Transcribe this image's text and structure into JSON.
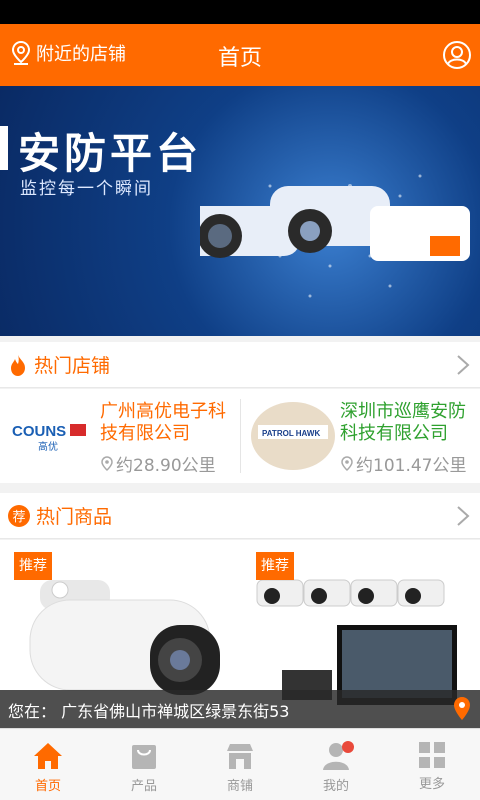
{
  "header": {
    "nearby_label": "附近的店铺",
    "title": "首页"
  },
  "banner": {
    "headline": "安防平台",
    "subtitle": "监控每一个瞬间"
  },
  "hot_stores": {
    "title": "热门店铺",
    "items": [
      {
        "logo_text": "COUNS",
        "logo_sub": "高优",
        "name": "广州高优电子科技有限公司",
        "distance": "约28.90公里"
      },
      {
        "logo_text": "PATROL HAWK",
        "name": "深圳市巡鹰安防科技有限公司",
        "distance": "约101.47公里"
      }
    ]
  },
  "hot_products": {
    "title": "热门商品",
    "section_icon_text": "荐",
    "items": [
      {
        "tag": "推荐"
      },
      {
        "tag": "推荐"
      }
    ]
  },
  "location": {
    "text": "您在：  广东省佛山市禅城区绿景东街53"
  },
  "tabs": [
    {
      "label": "首页",
      "icon": "home-icon",
      "active": true
    },
    {
      "label": "产品",
      "icon": "bag-icon",
      "active": false
    },
    {
      "label": "商铺",
      "icon": "shop-icon",
      "active": false
    },
    {
      "label": "我的",
      "icon": "person-icon",
      "active": false
    },
    {
      "label": "更多",
      "icon": "grid-icon",
      "active": false
    }
  ],
  "colors": {
    "accent": "#ff6a00",
    "store1_name": "#ff6a00",
    "store2_name": "#2fa12f"
  }
}
